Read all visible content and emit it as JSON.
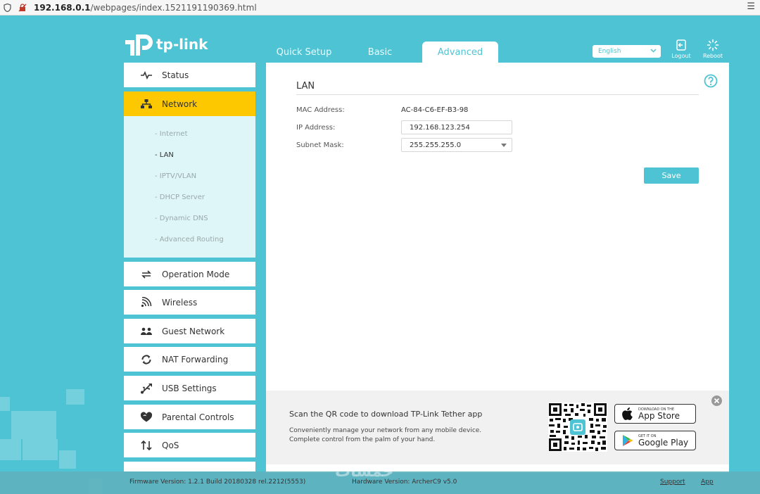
{
  "browser": {
    "url_host": "192.168.0.1",
    "url_path": "/webpages/index.1521191190369.html",
    "menu_glyph": "☰"
  },
  "brand": {
    "logo_text": "tp-link",
    "accent": "#4ec3d3",
    "active_color": "#fdc800"
  },
  "tabs": [
    {
      "label": "Quick Setup"
    },
    {
      "label": "Basic"
    },
    {
      "label": "Advanced"
    }
  ],
  "top": {
    "language": "English",
    "logout_label": "Logout",
    "reboot_label": "Reboot"
  },
  "sidebar": {
    "items": [
      {
        "label": "Status",
        "icon": "pulse-icon"
      },
      {
        "label": "Network",
        "icon": "network-icon"
      },
      {
        "label": "Operation Mode",
        "icon": "operation-mode-icon"
      },
      {
        "label": "Wireless",
        "icon": "wireless-icon"
      },
      {
        "label": "Guest Network",
        "icon": "guest-icon"
      },
      {
        "label": "NAT Forwarding",
        "icon": "nat-icon"
      },
      {
        "label": "USB Settings",
        "icon": "usb-icon"
      },
      {
        "label": "Parental Controls",
        "icon": "heart-icon"
      },
      {
        "label": "QoS",
        "icon": "qos-icon"
      }
    ],
    "network_sub": [
      "- Internet",
      "- LAN",
      "- IPTV/VLAN",
      "- DHCP Server",
      "- Dynamic DNS",
      "- Advanced Routing"
    ]
  },
  "main": {
    "title": "LAN",
    "mac_label": "MAC Address:",
    "mac_value": "AC-84-C6-EF-B3-98",
    "ip_label": "IP Address:",
    "ip_value": "192.168.123.254",
    "mask_label": "Subnet Mask:",
    "mask_value": "255.255.255.0",
    "save_label": "Save"
  },
  "promo": {
    "title": "Scan the QR code to download TP-Link Tether app",
    "desc1": "Conveniently manage your network from any mobile device.",
    "desc2": "Complete control from the palm of your hand.",
    "appstore_small": "DOWNLOAD ON THE",
    "appstore_big": "App Store",
    "gplay_small": "GET IT ON",
    "gplay_big": "Google Play"
  },
  "footer": {
    "firmware": "Firmware Version: 1.2.1 Build 20180328 rel.2212(5553)",
    "hardware": "Hardware Version: ArcherC9 v5.0",
    "support": "Support",
    "app": "App",
    "watermark": "خمسات"
  }
}
